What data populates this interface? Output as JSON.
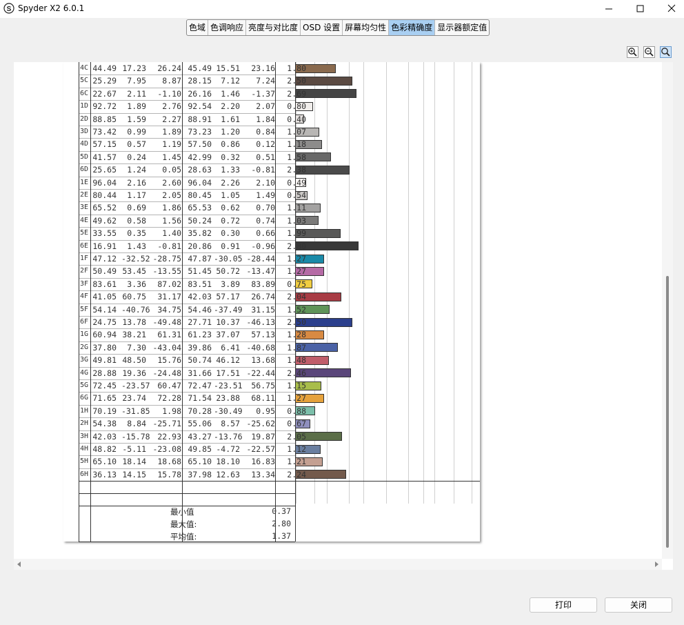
{
  "window": {
    "title": "Spyder X2 6.0.1"
  },
  "tabs": [
    {
      "label": "色域",
      "active": false
    },
    {
      "label": "色调响应",
      "active": false
    },
    {
      "label": "亮度与对比度",
      "active": false
    },
    {
      "label": "OSD 设置",
      "active": false
    },
    {
      "label": "屏幕均匀性",
      "active": false
    },
    {
      "label": "色彩精确度",
      "active": true
    },
    {
      "label": "显示器额定值",
      "active": false
    }
  ],
  "zoom_icons": [
    "zoom-in-icon",
    "zoom-out-icon",
    "zoom-fit-icon"
  ],
  "table": {
    "rows": [
      {
        "id": "4C",
        "l1": "44.49",
        "a1": "17.23",
        "b1": "26.24",
        "l2": "45.49",
        "a2": "15.51",
        "b2": "23.16",
        "de": "1.80",
        "delta": 1.8,
        "color": "#8a6a4e"
      },
      {
        "id": "5C",
        "l1": "25.29",
        "a1": "7.95",
        "b1": "8.87",
        "l2": "28.15",
        "a2": "7.12",
        "b2": "7.24",
        "de": "2.50",
        "delta": 2.5,
        "color": "#5b4a42"
      },
      {
        "id": "6C",
        "l1": "22.67",
        "a1": "2.11",
        "b1": "-1.10",
        "l2": "26.16",
        "a2": "1.46",
        "b2": "-1.37",
        "de": "2.69",
        "delta": 2.69,
        "color": "#454545"
      },
      {
        "id": "1D",
        "l1": "92.72",
        "a1": "1.89",
        "b1": "2.76",
        "l2": "92.54",
        "a2": "2.20",
        "b2": "2.07",
        "de": "0.80",
        "delta": 0.8,
        "color": "#f1eeec"
      },
      {
        "id": "2D",
        "l1": "88.85",
        "a1": "1.59",
        "b1": "2.27",
        "l2": "88.91",
        "a2": "1.61",
        "b2": "1.84",
        "de": "0.40",
        "delta": 0.4,
        "color": "#e6e2e0"
      },
      {
        "id": "3D",
        "l1": "73.42",
        "a1": "0.99",
        "b1": "1.89",
        "l2": "73.23",
        "a2": "1.20",
        "b2": "0.84",
        "de": "1.07",
        "delta": 1.07,
        "color": "#b8b6b4"
      },
      {
        "id": "4D",
        "l1": "57.15",
        "a1": "0.57",
        "b1": "1.19",
        "l2": "57.50",
        "a2": "0.86",
        "b2": "0.12",
        "de": "1.18",
        "delta": 1.18,
        "color": "#8d8c8b"
      },
      {
        "id": "5D",
        "l1": "41.57",
        "a1": "0.24",
        "b1": "1.45",
        "l2": "42.99",
        "a2": "0.32",
        "b2": "0.51",
        "de": "1.58",
        "delta": 1.58,
        "color": "#696969"
      },
      {
        "id": "6D",
        "l1": "25.65",
        "a1": "1.24",
        "b1": "0.05",
        "l2": "28.63",
        "a2": "1.33",
        "b2": "-0.81",
        "de": "2.38",
        "delta": 2.38,
        "color": "#4a4a4a"
      },
      {
        "id": "1E",
        "l1": "96.04",
        "a1": "2.16",
        "b1": "2.60",
        "l2": "96.04",
        "a2": "2.26",
        "b2": "2.10",
        "de": "0.49",
        "delta": 0.49,
        "color": "#f9f6f4"
      },
      {
        "id": "2E",
        "l1": "80.44",
        "a1": "1.17",
        "b1": "2.05",
        "l2": "80.45",
        "a2": "1.05",
        "b2": "1.49",
        "de": "0.54",
        "delta": 0.54,
        "color": "#cbc8c6"
      },
      {
        "id": "3E",
        "l1": "65.52",
        "a1": "0.69",
        "b1": "1.86",
        "l2": "65.53",
        "a2": "0.62",
        "b2": "0.70",
        "de": "1.11",
        "delta": 1.11,
        "color": "#a3a2a1"
      },
      {
        "id": "4E",
        "l1": "49.62",
        "a1": "0.58",
        "b1": "1.56",
        "l2": "50.24",
        "a2": "0.72",
        "b2": "0.74",
        "de": "1.03",
        "delta": 1.03,
        "color": "#7b7a79"
      },
      {
        "id": "5E",
        "l1": "33.55",
        "a1": "0.35",
        "b1": "1.40",
        "l2": "35.82",
        "a2": "0.30",
        "b2": "0.66",
        "de": "1.99",
        "delta": 1.99,
        "color": "#595958"
      },
      {
        "id": "6E",
        "l1": "16.91",
        "a1": "1.43",
        "b1": "-0.81",
        "l2": "20.86",
        "a2": "0.91",
        "b2": "-0.96",
        "de": "2.80",
        "delta": 2.8,
        "color": "#383838"
      },
      {
        "id": "1F",
        "l1": "47.12",
        "a1": "-32.52",
        "b1": "-28.75",
        "l2": "47.87",
        "a2": "-30.05",
        "b2": "-28.44",
        "de": "1.27",
        "delta": 1.27,
        "color": "#1a8aa8"
      },
      {
        "id": "2F",
        "l1": "50.49",
        "a1": "53.45",
        "b1": "-13.55",
        "l2": "51.45",
        "a2": "50.72",
        "b2": "-13.47",
        "de": "1.27",
        "delta": 1.27,
        "color": "#b56aa5"
      },
      {
        "id": "3F",
        "l1": "83.61",
        "a1": "3.36",
        "b1": "87.02",
        "l2": "83.51",
        "a2": "3.89",
        "b2": "83.89",
        "de": "0.75",
        "delta": 0.75,
        "color": "#f0cd40"
      },
      {
        "id": "4F",
        "l1": "41.05",
        "a1": "60.75",
        "b1": "31.17",
        "l2": "42.03",
        "a2": "57.17",
        "b2": "26.74",
        "de": "2.04",
        "delta": 2.04,
        "color": "#a83c44"
      },
      {
        "id": "5F",
        "l1": "54.14",
        "a1": "-40.76",
        "b1": "34.75",
        "l2": "54.46",
        "a2": "-37.49",
        "b2": "31.15",
        "de": "1.52",
        "delta": 1.52,
        "color": "#5f9458"
      },
      {
        "id": "6F",
        "l1": "24.75",
        "a1": "13.78",
        "b1": "-49.48",
        "l2": "27.71",
        "a2": "10.37",
        "b2": "-46.13",
        "de": "2.50",
        "delta": 2.5,
        "color": "#2b3f8c"
      },
      {
        "id": "1G",
        "l1": "60.94",
        "a1": "38.21",
        "b1": "61.31",
        "l2": "61.23",
        "a2": "37.07",
        "b2": "57.13",
        "de": "1.28",
        "delta": 1.28,
        "color": "#d88a42"
      },
      {
        "id": "2G",
        "l1": "37.80",
        "a1": "7.30",
        "b1": "-43.04",
        "l2": "39.86",
        "a2": "6.41",
        "b2": "-40.68",
        "de": "1.87",
        "delta": 1.87,
        "color": "#4a62a6"
      },
      {
        "id": "3G",
        "l1": "49.81",
        "a1": "48.50",
        "b1": "15.76",
        "l2": "50.74",
        "a2": "46.12",
        "b2": "13.68",
        "de": "1.48",
        "delta": 1.48,
        "color": "#c05e6a"
      },
      {
        "id": "4G",
        "l1": "28.88",
        "a1": "19.36",
        "b1": "-24.48",
        "l2": "31.66",
        "a2": "17.51",
        "b2": "-22.44",
        "de": "2.46",
        "delta": 2.46,
        "color": "#5a467a"
      },
      {
        "id": "5G",
        "l1": "72.45",
        "a1": "-23.57",
        "b1": "60.47",
        "l2": "72.47",
        "a2": "-23.51",
        "b2": "56.75",
        "de": "1.15",
        "delta": 1.15,
        "color": "#a8bd4a"
      },
      {
        "id": "6G",
        "l1": "71.65",
        "a1": "23.74",
        "b1": "72.28",
        "l2": "71.54",
        "a2": "23.88",
        "b2": "68.11",
        "de": "1.27",
        "delta": 1.27,
        "color": "#e6a23c"
      },
      {
        "id": "1H",
        "l1": "70.19",
        "a1": "-31.85",
        "b1": "1.98",
        "l2": "70.28",
        "a2": "-30.49",
        "b2": "0.95",
        "de": "0.88",
        "delta": 0.88,
        "color": "#7cbfaa"
      },
      {
        "id": "2H",
        "l1": "54.38",
        "a1": "8.84",
        "b1": "-25.71",
        "l2": "55.06",
        "a2": "8.57",
        "b2": "-25.62",
        "de": "0.67",
        "delta": 0.67,
        "color": "#8f8fbe"
      },
      {
        "id": "3H",
        "l1": "42.03",
        "a1": "-15.78",
        "b1": "22.93",
        "l2": "43.27",
        "a2": "-13.76",
        "b2": "19.87",
        "de": "2.05",
        "delta": 2.05,
        "color": "#5b6e48"
      },
      {
        "id": "4H",
        "l1": "48.82",
        "a1": "-5.11",
        "b1": "-23.08",
        "l2": "49.85",
        "a2": "-4.72",
        "b2": "-22.57",
        "de": "1.12",
        "delta": 1.12,
        "color": "#6a7fa0"
      },
      {
        "id": "5H",
        "l1": "65.10",
        "a1": "18.14",
        "b1": "18.68",
        "l2": "65.10",
        "a2": "18.10",
        "b2": "16.83",
        "de": "1.21",
        "delta": 1.21,
        "color": "#c4a092"
      },
      {
        "id": "6H",
        "l1": "36.13",
        "a1": "14.15",
        "b1": "15.78",
        "l2": "37.98",
        "a2": "12.63",
        "b2": "13.34",
        "de": "2.24",
        "delta": 2.24,
        "color": "#735a4c"
      }
    ],
    "stats": [
      {
        "label": "最小值",
        "value": "0.37"
      },
      {
        "label": "最大值:",
        "value": "2.80"
      },
      {
        "label": "平均值:",
        "value": "1.37"
      }
    ]
  },
  "buttons": {
    "print": "打印",
    "close": "关闭"
  }
}
